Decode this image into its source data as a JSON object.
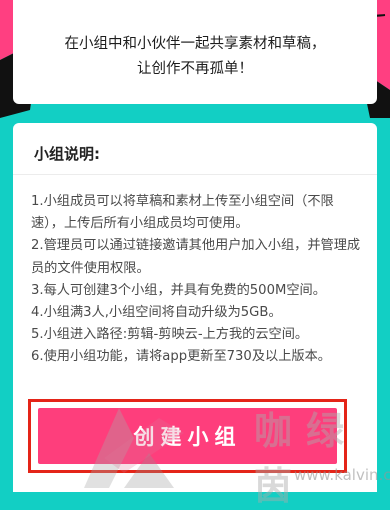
{
  "header": {
    "intro_line1": "在小组中和小伙伴一起共享素材和草稿，",
    "intro_line2": "让创作不再孤单！"
  },
  "info": {
    "title": "小组说明:",
    "rules": [
      "1.小组成员可以将草稿和素材上传至小组空间（不限速），上传后所有小组成员均可使用。",
      "2.管理员可以通过链接邀请其他用户加入小组，并管理成员的文件使用权限。",
      "3.每人可创建3个小组，并具有免费的500M空间。",
      "4.小组满3人,小组空间将自动升级为5GB。",
      "5.小组进入路径:剪辑-剪映云-上方我的云空间。",
      "6.使用小组功能，请将app更新至730及以上版本。"
    ]
  },
  "actions": {
    "create_label": "创建小组"
  },
  "watermark": {
    "text": "咖绿茵",
    "url": "www.kalvin.cn"
  },
  "colors": {
    "background": "#12cfc4",
    "accent_pink": "#fe3e7c",
    "highlight_red": "#e42418"
  }
}
